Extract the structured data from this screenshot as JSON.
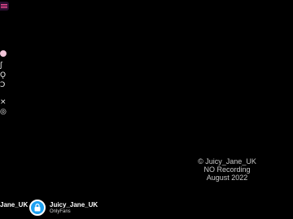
{
  "menu": {
    "icon": "menu-icon",
    "accent_color": "#ff4f9a"
  },
  "left_rail": {
    "items": [
      {
        "icon": "record-dot-icon",
        "glyph": ""
      },
      {
        "icon": "hand-icon",
        "glyph": "ʃ"
      },
      {
        "icon": "wave-icon",
        "glyph": "Ǫ"
      },
      {
        "icon": "spiral-icon",
        "glyph": "Ɔ"
      },
      {
        "icon": "close-icon",
        "glyph": "×"
      },
      {
        "icon": "circle-icon",
        "glyph": "◎"
      }
    ]
  },
  "watermark": {
    "line1": "© Juicy_Jane_UK",
    "line2": "NO Recording",
    "line3": "August 2022"
  },
  "footer": {
    "left_name": "Jane_UK",
    "account": {
      "name": "Juicy_Jane_UK",
      "platform": "OnlyFans",
      "avatar_color": "#1da1f2",
      "icon": "lock-icon"
    }
  }
}
